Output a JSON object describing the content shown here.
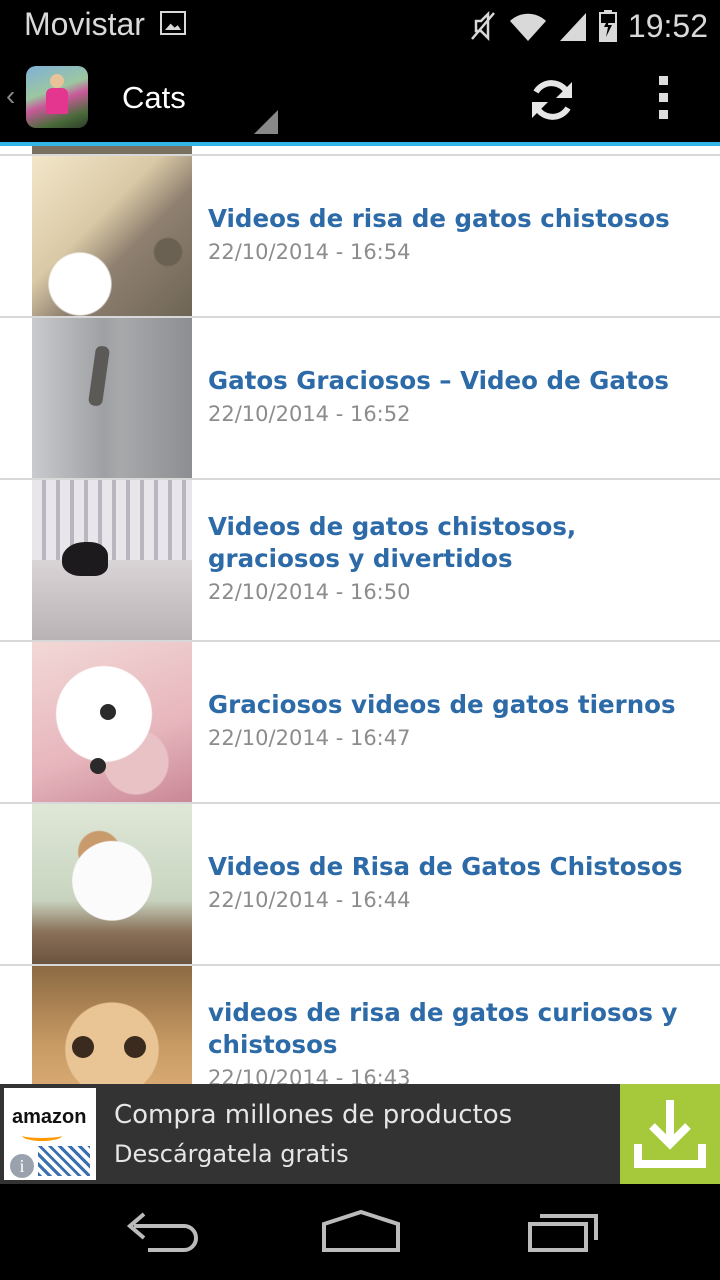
{
  "status_bar": {
    "carrier": "Movistar",
    "time": "19:52"
  },
  "action_bar": {
    "title": "Cats"
  },
  "videos": [
    {
      "title": "Videos de risa de gatos chistosos",
      "date": "22/10/2014 - 16:54"
    },
    {
      "title": "Gatos Graciosos – Video de Gatos",
      "date": "22/10/2014 - 16:52"
    },
    {
      "title": "Videos de gatos chistosos, graciosos y divertidos",
      "date": "22/10/2014 - 16:50"
    },
    {
      "title": "Graciosos videos de gatos tiernos",
      "date": "22/10/2014 - 16:47"
    },
    {
      "title": "Videos de Risa de Gatos Chistosos",
      "date": "22/10/2014 - 16:44"
    },
    {
      "title": "videos de risa de gatos curiosos y chistosos",
      "date": "22/10/2014 - 16:43"
    }
  ],
  "ad": {
    "logo_text": "amazon",
    "line1": "Compra millones de productos",
    "line2": "Descárgatela gratis",
    "accent_color": "#a6c93c"
  },
  "colors": {
    "accent": "#33b5e5",
    "title": "#2d6aa8",
    "date": "#8c8c8c"
  }
}
